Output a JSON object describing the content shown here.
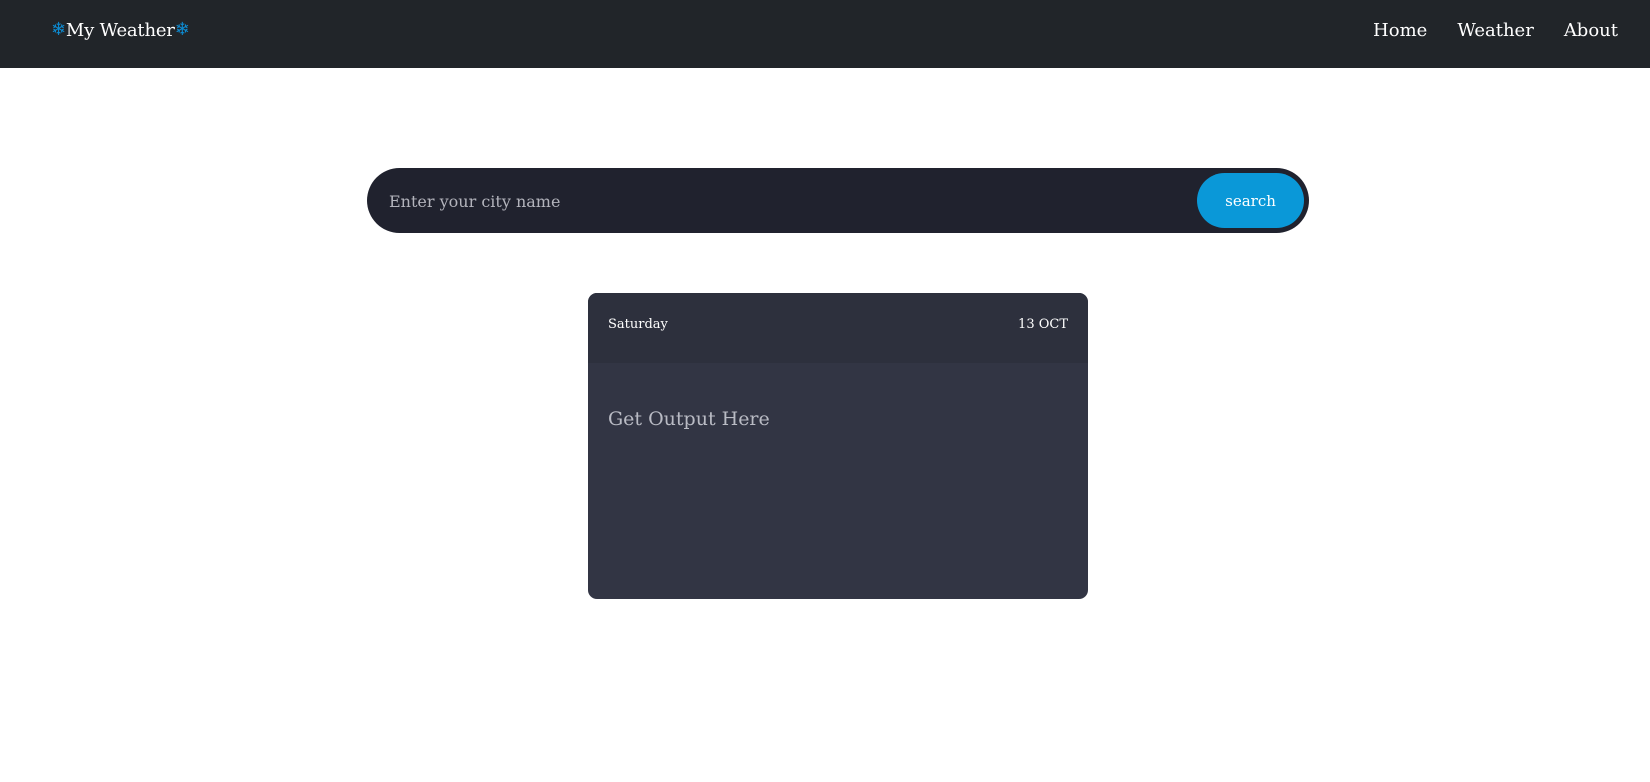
{
  "navbar": {
    "brand_icon": "snowflake-icon",
    "brand_title": "My Weather",
    "brand_icon_color": "#0d8bd1",
    "links": [
      {
        "label": "Home"
      },
      {
        "label": "Weather"
      },
      {
        "label": "About"
      }
    ]
  },
  "search": {
    "placeholder": "Enter your city name",
    "value": "",
    "button_label": "search",
    "button_color": "#0a98d8"
  },
  "card": {
    "day": "Saturday",
    "date": "13 OCT",
    "output_text": "Get Output Here"
  },
  "colors": {
    "navbar_bg": "#212529",
    "search_bg": "#20222e",
    "card_bg": "#323544",
    "card_header_bg": "#2d303d"
  }
}
